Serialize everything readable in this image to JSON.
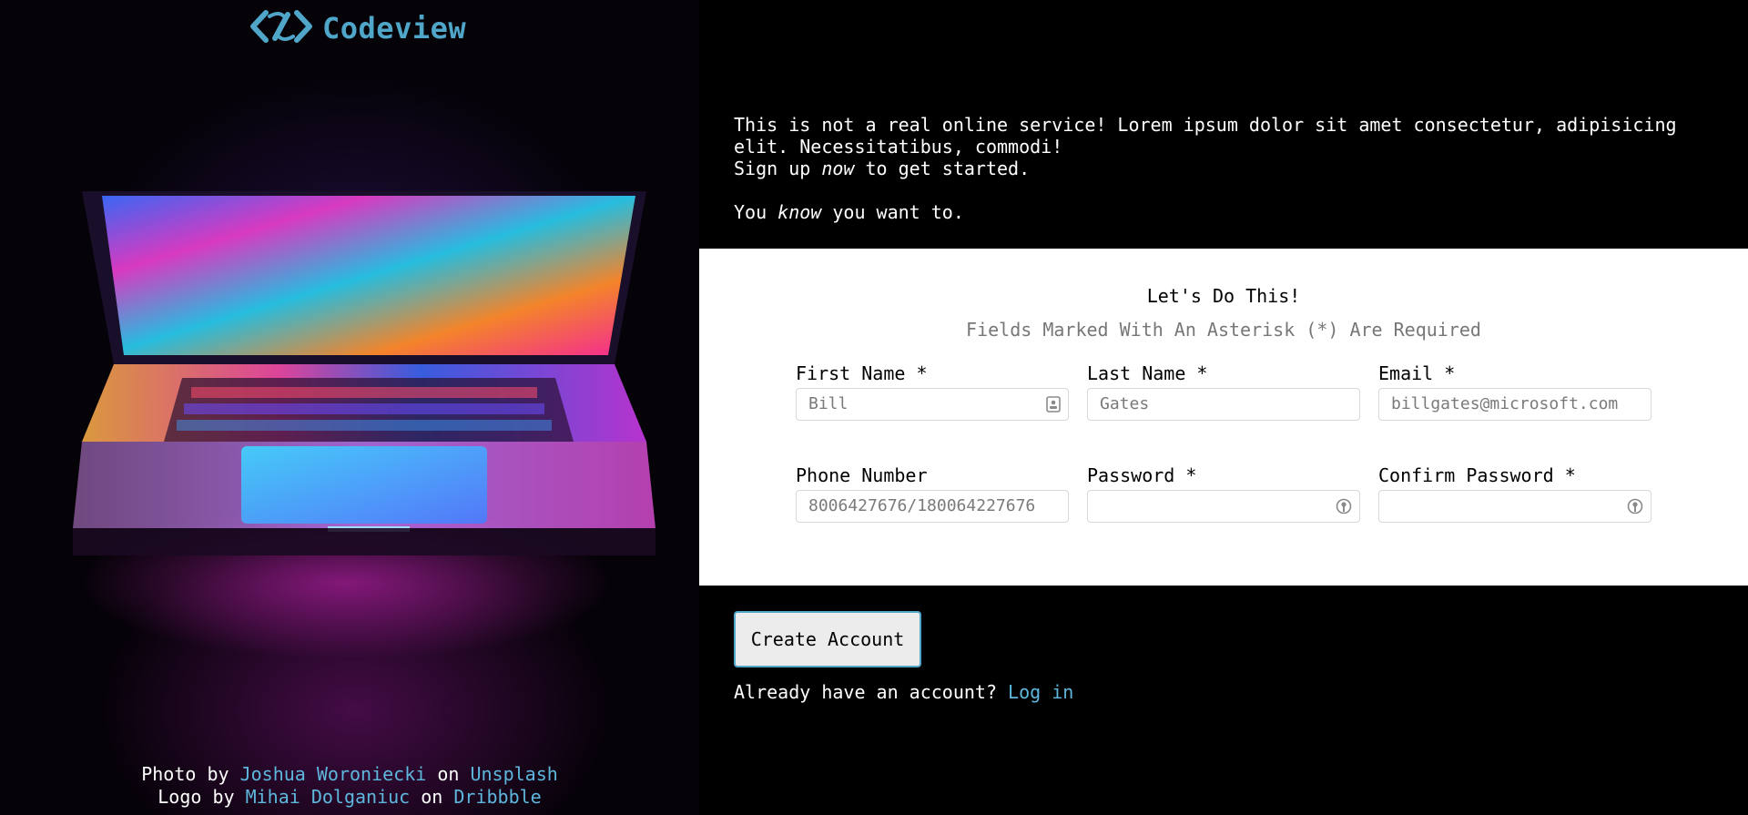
{
  "brand": {
    "name": "Codeview",
    "logo_icon": "codeview-logo-icon",
    "accent_color": "#4fa6c8"
  },
  "intro": {
    "line1": "This is not a real online service! Lorem ipsum dolor sit amet consectetur, adipisicing elit. Necessitatibus, commodi!",
    "line2_pre": "Sign up ",
    "line2_em": "now",
    "line2_post": " to get started.",
    "line3_pre": "You ",
    "line3_em": "know",
    "line3_post": " you want to."
  },
  "form": {
    "title": "Let's Do This!",
    "subtitle": "Fields Marked With An Asterisk (*) Are Required",
    "fields": [
      {
        "label": "First Name *",
        "placeholder": "Bill",
        "icon": "contact-card-icon"
      },
      {
        "label": "Last Name *",
        "placeholder": "Gates"
      },
      {
        "label": "Email *",
        "placeholder": "billgates@microsoft.com"
      },
      {
        "label": "Phone Number",
        "placeholder": "8006427676/180064227676"
      },
      {
        "label": "Password *",
        "placeholder": "",
        "icon": "password-key-icon"
      },
      {
        "label": "Confirm Password *",
        "placeholder": "",
        "icon": "password-key-icon"
      }
    ]
  },
  "actions": {
    "create_label": "Create Account",
    "login_prompt": "Already have an account? ",
    "login_link": "Log in"
  },
  "credits": {
    "photo_pre": "Photo by ",
    "photo_author": "Joshua Woroniecki",
    "on1": " on ",
    "photo_site": "Unsplash",
    "logo_pre": "Logo by ",
    "logo_author": "Mihai Dolganiuc",
    "on2": " on ",
    "logo_site": "Dribbble"
  }
}
